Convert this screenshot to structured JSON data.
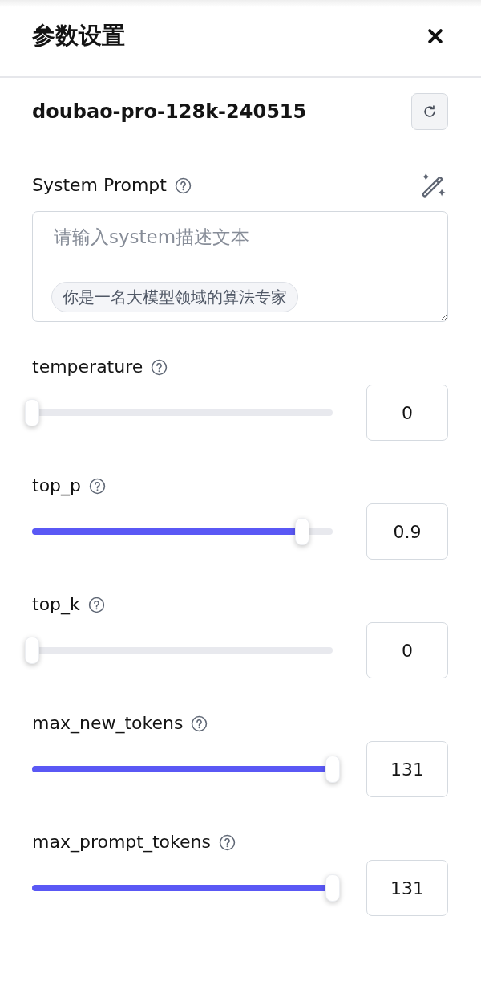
{
  "panel": {
    "title": "参数设置",
    "model": {
      "name": "doubao-pro-128k-240515"
    },
    "system_prompt": {
      "label": "System Prompt",
      "placeholder": "请输入system描述文本",
      "suggestions": [
        "你是一名大模型领域的算法专家"
      ]
    },
    "params": [
      {
        "label": "temperature",
        "level": 0,
        "value": "0"
      },
      {
        "label": "top_p",
        "level": 0.9,
        "value": "0.9"
      },
      {
        "label": "top_k",
        "level": 0,
        "value": "0"
      },
      {
        "label": "max_new_tokens",
        "level": 1,
        "value": "131"
      },
      {
        "label": "max_prompt_tokens",
        "level": 1,
        "value": "131"
      }
    ]
  }
}
